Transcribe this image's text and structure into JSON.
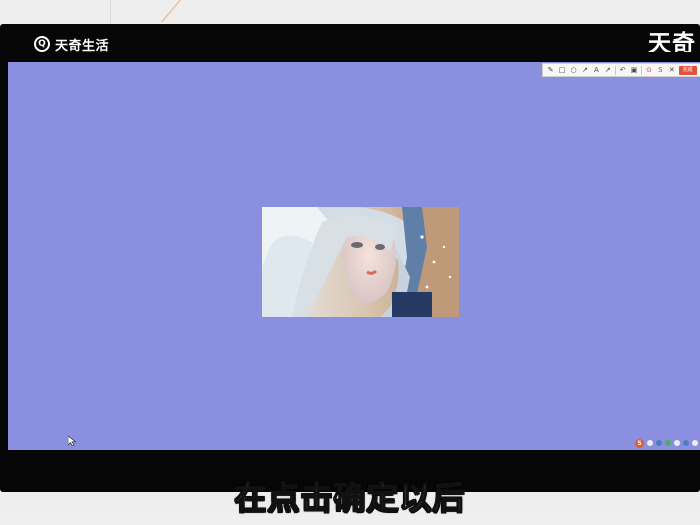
{
  "watermark": {
    "brand_name": "天奇生活",
    "logo_letter": "Q",
    "corner_text": "天奇"
  },
  "screenshot_tool": {
    "tools": [
      {
        "id": "pen",
        "glyph": "✎"
      },
      {
        "id": "rectangle",
        "glyph": "□"
      },
      {
        "id": "ellipse",
        "glyph": "○"
      },
      {
        "id": "arrow",
        "glyph": "↗"
      },
      {
        "id": "text",
        "glyph": "A"
      },
      {
        "id": "brush",
        "glyph": "↗"
      },
      {
        "id": "undo",
        "glyph": "↶"
      },
      {
        "id": "save",
        "glyph": "▣"
      },
      {
        "id": "pin",
        "glyph": "⊙"
      },
      {
        "id": "share",
        "glyph": "S"
      },
      {
        "id": "close",
        "glyph": "✕"
      }
    ],
    "done_button_label": "完成"
  },
  "caption": {
    "text": "在点击确定以后"
  },
  "colors": {
    "screen_background": "#8a90df",
    "monitor_bezel": "#060606",
    "accent_red": "#e2513c"
  }
}
